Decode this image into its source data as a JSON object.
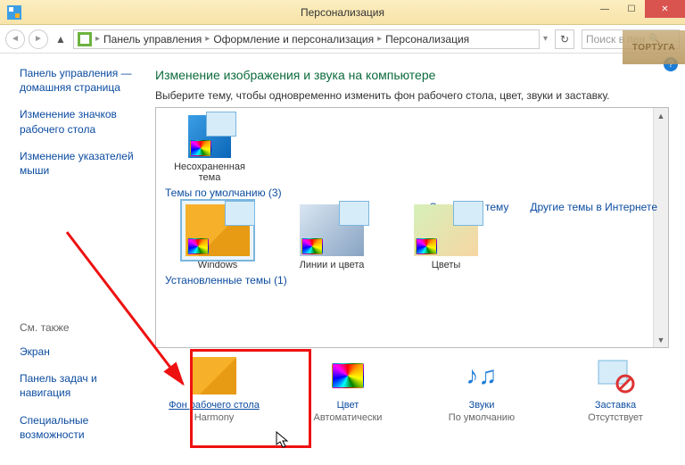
{
  "title": "Персонализация",
  "breadcrumbs": {
    "root": "Панель управления",
    "mid": "Оформление и персонализация",
    "leaf": "Персонализация"
  },
  "search_placeholder": "Поиск в пан",
  "sidebar": {
    "links": [
      "Панель управления — домашняя страница",
      "Изменение значков рабочего стола",
      "Изменение указателей мыши"
    ],
    "see_also_hdr": "См. также",
    "see_also": [
      "Экран",
      "Панель задач и навигация",
      "Специальные возможности"
    ]
  },
  "main": {
    "header": "Изменение изображения и звука на компьютере",
    "sub": "Выберите тему, чтобы одновременно изменить фон рабочего стола, цвет, звуки и заставку.",
    "unsaved_label": "Несохраненная тема",
    "default_hdr": "Темы по умолчанию (3)",
    "installed_hdr": "Установленные темы (1)",
    "themes": {
      "t1": "Windows",
      "t2": "Линии и цвета",
      "t3": "Цветы"
    },
    "links": {
      "save": "Сохранить тему",
      "more": "Другие темы в Интернете"
    },
    "bottom": {
      "b1": {
        "link": "Фон рабочего стола",
        "sub": "Harmony"
      },
      "b2": {
        "link": "Цвет",
        "sub": "Автоматически"
      },
      "b3": {
        "link": "Звуки",
        "sub": "По умолчанию"
      },
      "b4": {
        "link": "Заставка",
        "sub": "Отсутствует"
      }
    }
  },
  "watermark": "ТОРТУГА"
}
